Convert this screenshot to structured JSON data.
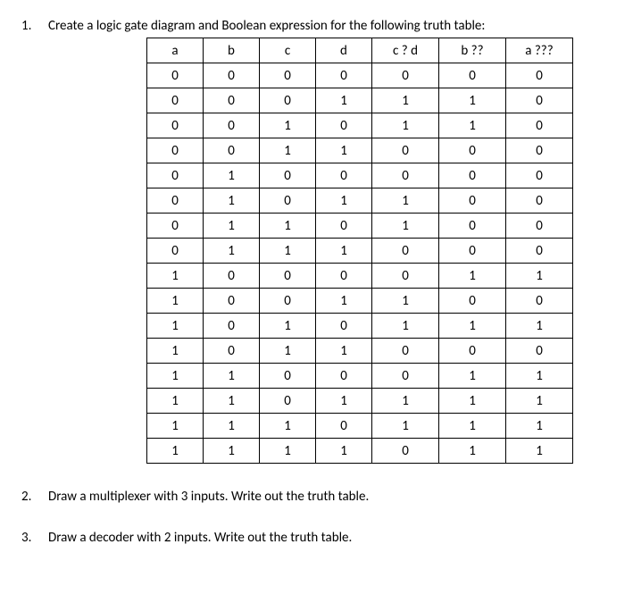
{
  "q1": {
    "number": "1.",
    "text": "Create a logic gate diagram and Boolean expression for the following truth table:",
    "headers": [
      "a",
      "b",
      "c",
      "d",
      "c ? d",
      "b ??",
      "a ???"
    ],
    "rows": [
      [
        "0",
        "0",
        "0",
        "0",
        "0",
        "0",
        "0"
      ],
      [
        "0",
        "0",
        "0",
        "1",
        "1",
        "1",
        "0"
      ],
      [
        "0",
        "0",
        "1",
        "0",
        "1",
        "1",
        "0"
      ],
      [
        "0",
        "0",
        "1",
        "1",
        "0",
        "0",
        "0"
      ],
      [
        "0",
        "1",
        "0",
        "0",
        "0",
        "0",
        "0"
      ],
      [
        "0",
        "1",
        "0",
        "1",
        "1",
        "0",
        "0"
      ],
      [
        "0",
        "1",
        "1",
        "0",
        "1",
        "0",
        "0"
      ],
      [
        "0",
        "1",
        "1",
        "1",
        "0",
        "0",
        "0"
      ],
      [
        "1",
        "0",
        "0",
        "0",
        "0",
        "1",
        "1"
      ],
      [
        "1",
        "0",
        "0",
        "1",
        "1",
        "0",
        "0"
      ],
      [
        "1",
        "0",
        "1",
        "0",
        "1",
        "1",
        "1"
      ],
      [
        "1",
        "0",
        "1",
        "1",
        "0",
        "0",
        "0"
      ],
      [
        "1",
        "1",
        "0",
        "0",
        "0",
        "1",
        "1"
      ],
      [
        "1",
        "1",
        "0",
        "1",
        "1",
        "1",
        "1"
      ],
      [
        "1",
        "1",
        "1",
        "0",
        "1",
        "1",
        "1"
      ],
      [
        "1",
        "1",
        "1",
        "1",
        "0",
        "1",
        "1"
      ]
    ]
  },
  "q2": {
    "number": "2.",
    "text": "Draw a multiplexer with 3 inputs. Write out the truth table."
  },
  "q3": {
    "number": "3.",
    "text": "Draw a decoder with 2 inputs. Write out the truth table."
  }
}
